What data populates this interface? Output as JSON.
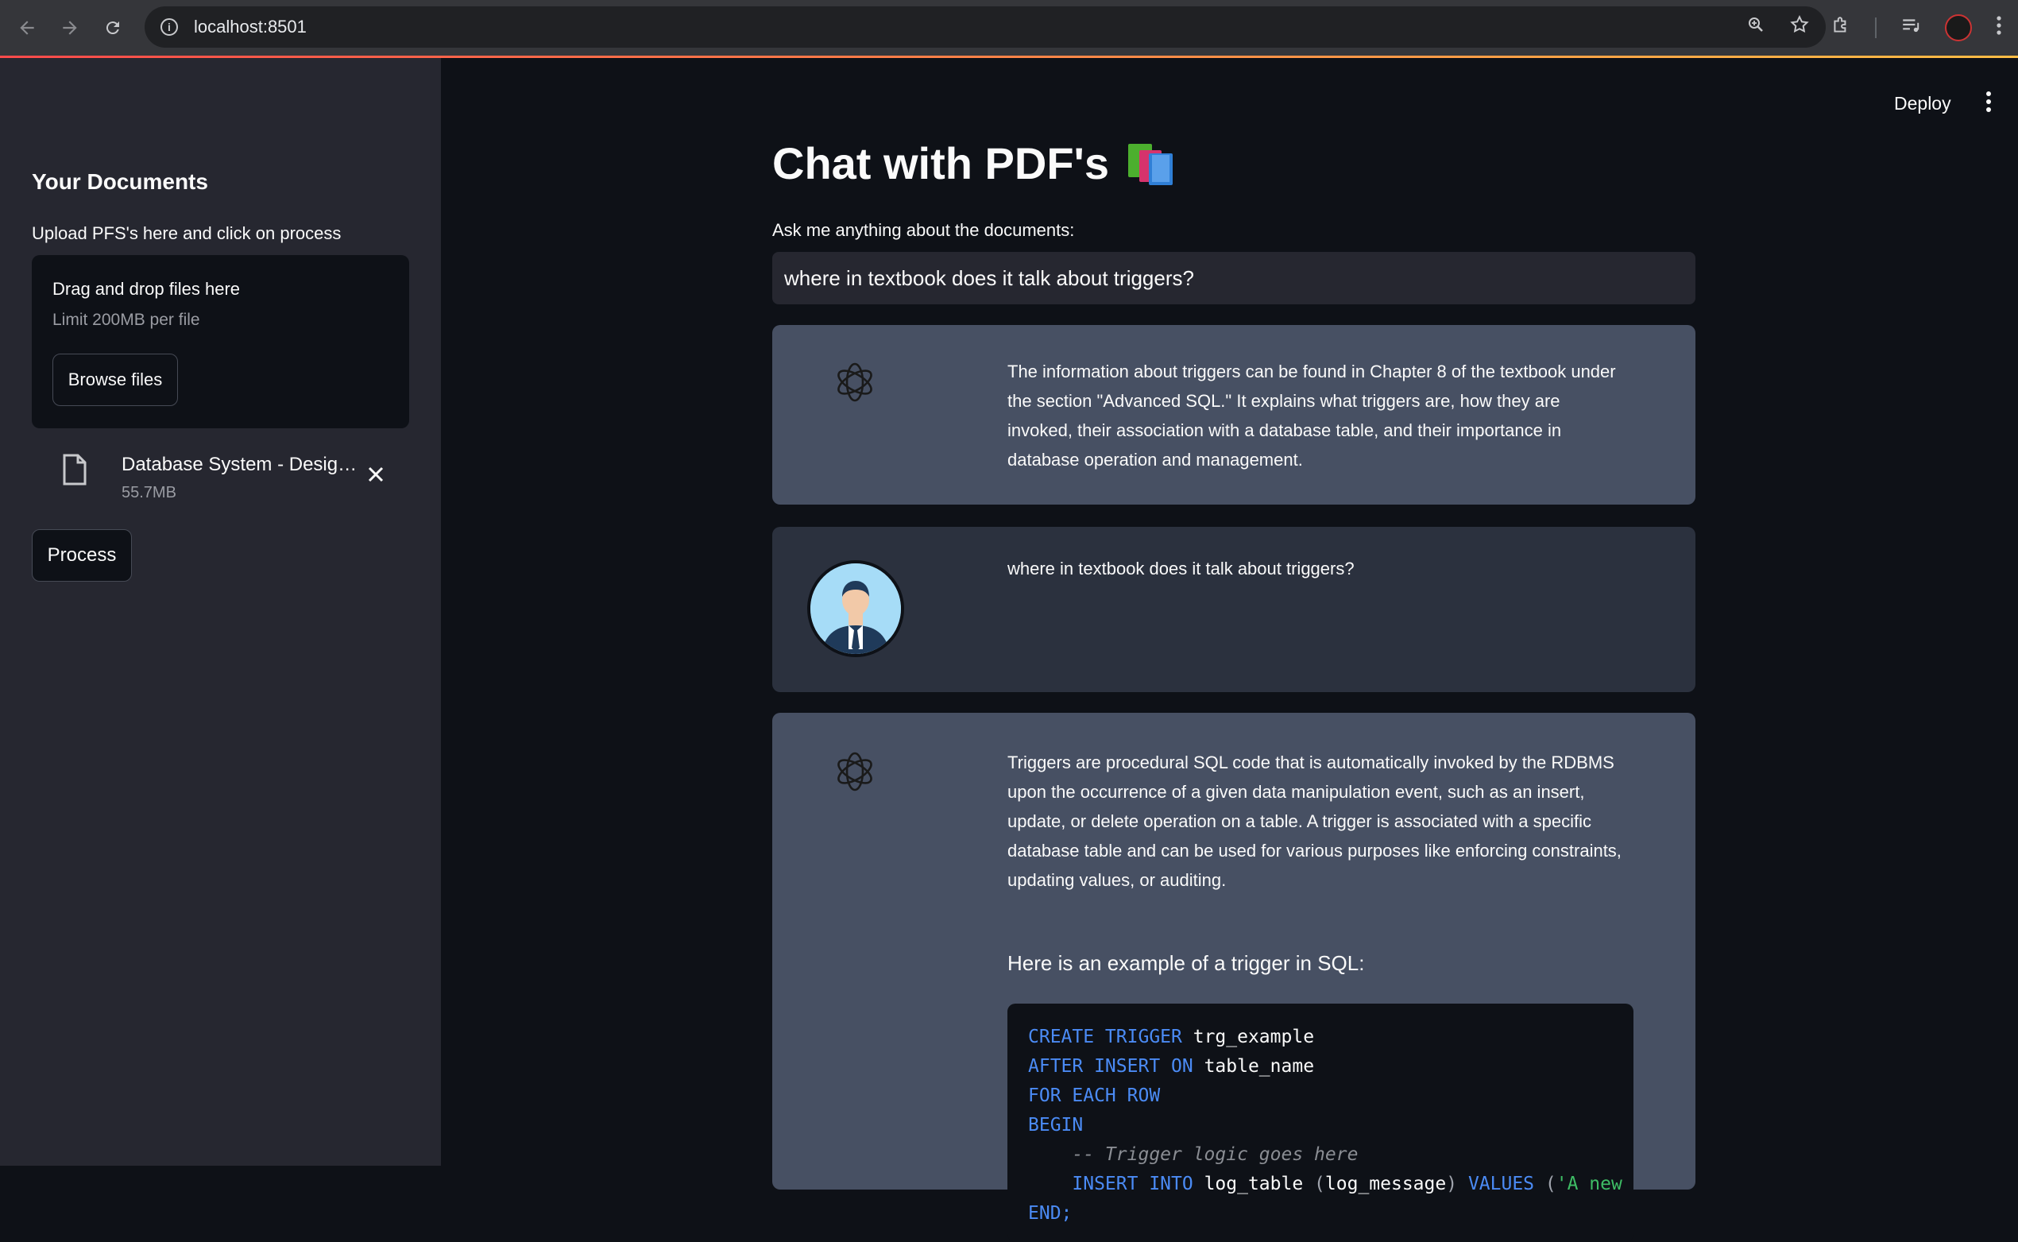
{
  "browser": {
    "url": "localhost:8501"
  },
  "sidebar": {
    "title": "Your Documents",
    "upload_label": "Upload PFS's here and click on process",
    "dropzone": {
      "title": "Drag and drop files here",
      "limit": "Limit 200MB per file",
      "browse_label": "Browse files"
    },
    "file": {
      "name": "Database System - Desig…",
      "size": "55.7MB"
    },
    "process_label": "Process"
  },
  "header": {
    "deploy_label": "Deploy"
  },
  "main": {
    "title": "Chat with PDF's",
    "ask_label": "Ask me anything about the documents:",
    "question_value": "where in textbook does it talk about triggers?"
  },
  "messages": [
    {
      "role": "bot",
      "text": "The information about triggers can be found in Chapter 8 of the textbook under the section \"Advanced SQL.\" It explains what triggers are, how they are invoked, their association with a database table, and their importance in database operation and management."
    },
    {
      "role": "user",
      "text": "where in textbook does it talk about triggers?"
    },
    {
      "role": "bot",
      "text": "Triggers are procedural SQL code that is automatically invoked by the RDBMS upon the occurrence of a given data manipulation event, such as an insert, update, or delete operation on a table. A trigger is associated with a specific database table and can be used for various purposes like enforcing constraints, updating values, or auditing.",
      "example_heading": "Here is an example of a trigger in SQL:",
      "code": {
        "l1_kw": "CREATE TRIGGER",
        "l1_id": " trg_example",
        "l2_kw": "AFTER INSERT ON",
        "l2_id": " table_name",
        "l3_kw": "FOR EACH ROW",
        "l4_kw": "BEGIN",
        "l5_cm": "    -- Trigger logic goes here",
        "l6_kw1": "    INSERT INTO",
        "l6_id1": " log_table ",
        "l6_p1": "(",
        "l6_id2": "log_message",
        "l6_p2": ") ",
        "l6_kw2": "VALUES",
        "l6_p3": " (",
        "l6_st": "'A new",
        "l7": "END;"
      }
    }
  ],
  "colors": {
    "sidebar_bg": "#262730",
    "main_bg": "#0e1117",
    "bot_msg_bg": "#475063",
    "user_msg_bg": "#2b313e",
    "keyword": "#4b8bf5",
    "string": "#3ebd65"
  }
}
